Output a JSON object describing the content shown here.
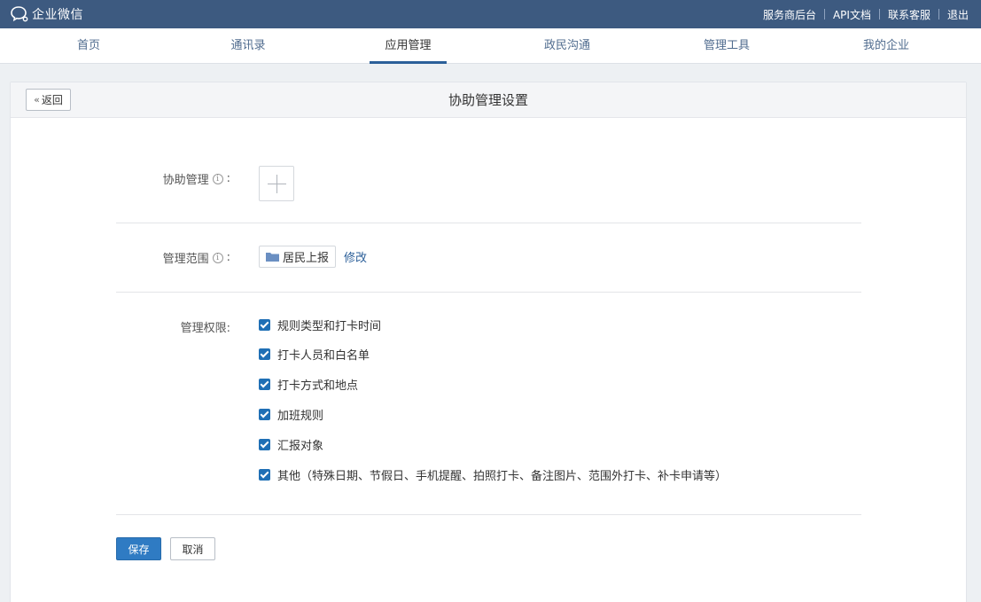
{
  "topbar": {
    "brand": "企业微信",
    "links": [
      "服务商后台",
      "API文档",
      "联系客服",
      "退出"
    ]
  },
  "nav": {
    "items": [
      "首页",
      "通讯录",
      "应用管理",
      "政民沟通",
      "管理工具",
      "我的企业"
    ],
    "active": "应用管理"
  },
  "page": {
    "back_label": "返回",
    "title": "协助管理设置"
  },
  "form": {
    "assist_label": "协助管理",
    "scope_label": "管理范围",
    "scope_value": "居民上报",
    "modify_label": "修改",
    "perm_label": "管理权限:",
    "colon": ":",
    "info_glyph": "i",
    "permissions": [
      "规则类型和打卡时间",
      "打卡人员和白名单",
      "打卡方式和地点",
      "加班规则",
      "汇报对象",
      "其他（特殊日期、节假日、手机提醒、拍照打卡、备注图片、范围外打卡、补卡申请等）"
    ]
  },
  "actions": {
    "save_label": "保存",
    "cancel_label": "取消"
  },
  "colors": {
    "topbar": "#3d5a80",
    "accent": "#2f7bc3",
    "checkbox": "#1f6fb5"
  }
}
